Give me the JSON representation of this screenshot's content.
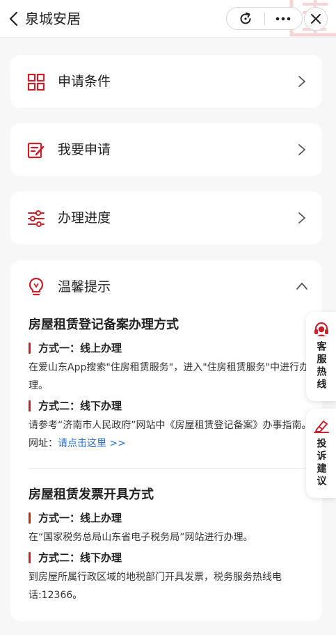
{
  "colors": {
    "accent": "#c7222c",
    "link": "#2a6fd1",
    "background": "#f7f7f7"
  },
  "navbar": {
    "title": "泉城安居",
    "icons": [
      "back-arrow-icon",
      "refresh-icon",
      "more-icon",
      "close-icon"
    ]
  },
  "menu": [
    {
      "label": "申请条件",
      "icon": "grid-icon"
    },
    {
      "label": "我要申请",
      "icon": "edit-form-icon"
    },
    {
      "label": "办理进度",
      "icon": "sliders-icon"
    }
  ],
  "tips": {
    "header": "温馨提示",
    "icon": "lightbulb-icon",
    "sections": [
      {
        "title": "房屋租赁登记备案办理方式",
        "items": [
          {
            "label": "方式一：线上办理",
            "text": "在爱山东App搜索\"住房租赁服务\"，进入\"住房租赁服务\"中进行办理。"
          },
          {
            "label": "方式二：线下办理",
            "text": "请参考“济南市人民政府”网站中《房屋租赁登记备案》办事指南。网址：",
            "link": "请点击这里 >>"
          }
        ]
      },
      {
        "title": "房屋租赁发票开具方式",
        "items": [
          {
            "label": "方式一：线上办理",
            "text": "在“国家税务总局山东省电子税务局”网站进行办理。"
          },
          {
            "label": "方式二：线下办理",
            "text": "到房屋所属行政区域的地税部门开具发票，税务服务热线电话:12366。"
          }
        ]
      }
    ]
  },
  "side_buttons": [
    {
      "label": "客服热线",
      "icon": "headset-icon"
    },
    {
      "label": "投诉建议",
      "icon": "complaint-pen-icon"
    }
  ]
}
